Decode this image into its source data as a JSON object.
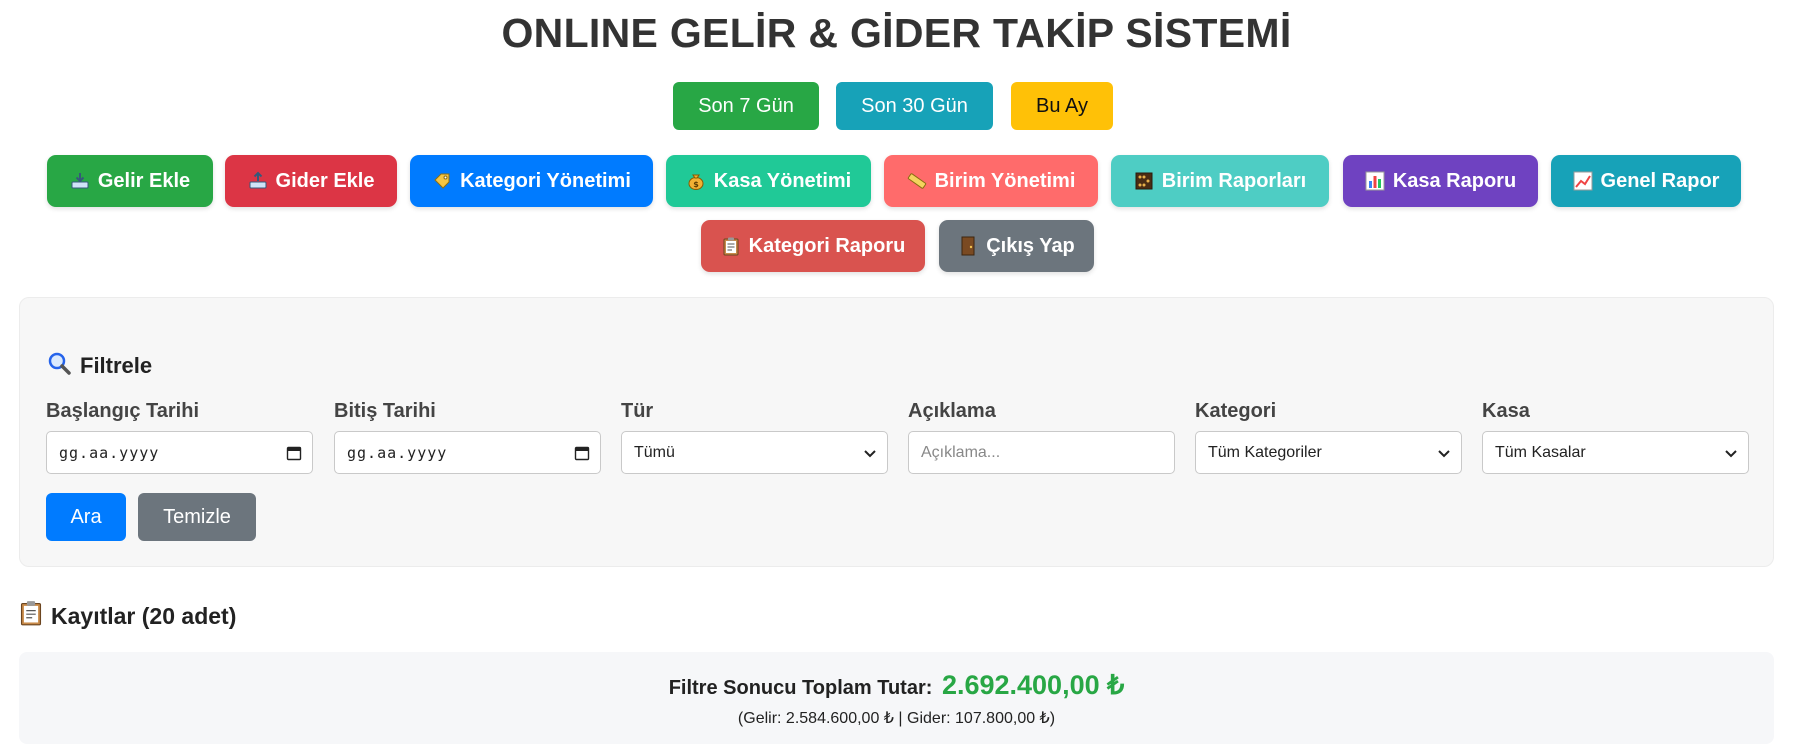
{
  "header": {
    "title": "ONLINE GELİR & GİDER TAKİP SİSTEMİ"
  },
  "quick_filters": [
    {
      "label": "Son 7 Gün",
      "color": "#28a745"
    },
    {
      "label": "Son 30 Gün",
      "color": "#17a2b8"
    },
    {
      "label": "Bu Ay",
      "color": "#ffc107"
    }
  ],
  "actions": [
    {
      "label": "Gelir Ekle",
      "icon": "inbox-tray-icon",
      "color": "#28a745"
    },
    {
      "label": "Gider Ekle",
      "icon": "outbox-tray-icon",
      "color": "#dc3545"
    },
    {
      "label": "Kategori Yönetimi",
      "icon": "tag-icon",
      "color": "#007bff"
    },
    {
      "label": "Kasa Yönetimi",
      "icon": "money-bag-icon",
      "color": "#20c997"
    },
    {
      "label": "Birim Yönetimi",
      "icon": "ruler-icon",
      "color": "#ff6b6b"
    },
    {
      "label": "Birim Raporları",
      "icon": "abacus-icon",
      "color": "#4ecdc4"
    },
    {
      "label": "Kasa Raporu",
      "icon": "bar-chart-icon",
      "color": "#6f42c1"
    },
    {
      "label": "Genel Rapor",
      "icon": "line-chart-icon",
      "color": "#17a2b8"
    },
    {
      "label": "Kategori Raporu",
      "icon": "clipboard-icon",
      "color": "#d9534f"
    },
    {
      "label": "Çıkış Yap",
      "icon": "door-icon",
      "color": "#6c757d"
    }
  ],
  "filter": {
    "title": "Filtrele",
    "icon": "magnifier-icon",
    "start_date_label": "Başlangıç Tarihi",
    "start_date_value": "gg.aa.yyyy",
    "end_date_label": "Bitiş Tarihi",
    "end_date_value": "gg.aa.yyyy",
    "type_label": "Tür",
    "type_value": "Tümü",
    "description_label": "Açıklama",
    "description_placeholder": "Açıklama...",
    "category_label": "Kategori",
    "category_value": "Tüm Kategoriler",
    "cashbox_label": "Kasa",
    "cashbox_value": "Tüm Kasalar",
    "search_label": "Ara",
    "clear_label": "Temizle"
  },
  "records": {
    "title": "Kayıtlar (20 adet)",
    "icon": "clipboard-icon"
  },
  "totals": {
    "label": "Filtre Sonucu Toplam Tutar:",
    "amount": "2.692.400,00 ₺",
    "breakdown": "(Gelir: 2.584.600,00 ₺ | Gider: 107.800,00 ₺)",
    "amount_color": "#28a745"
  }
}
